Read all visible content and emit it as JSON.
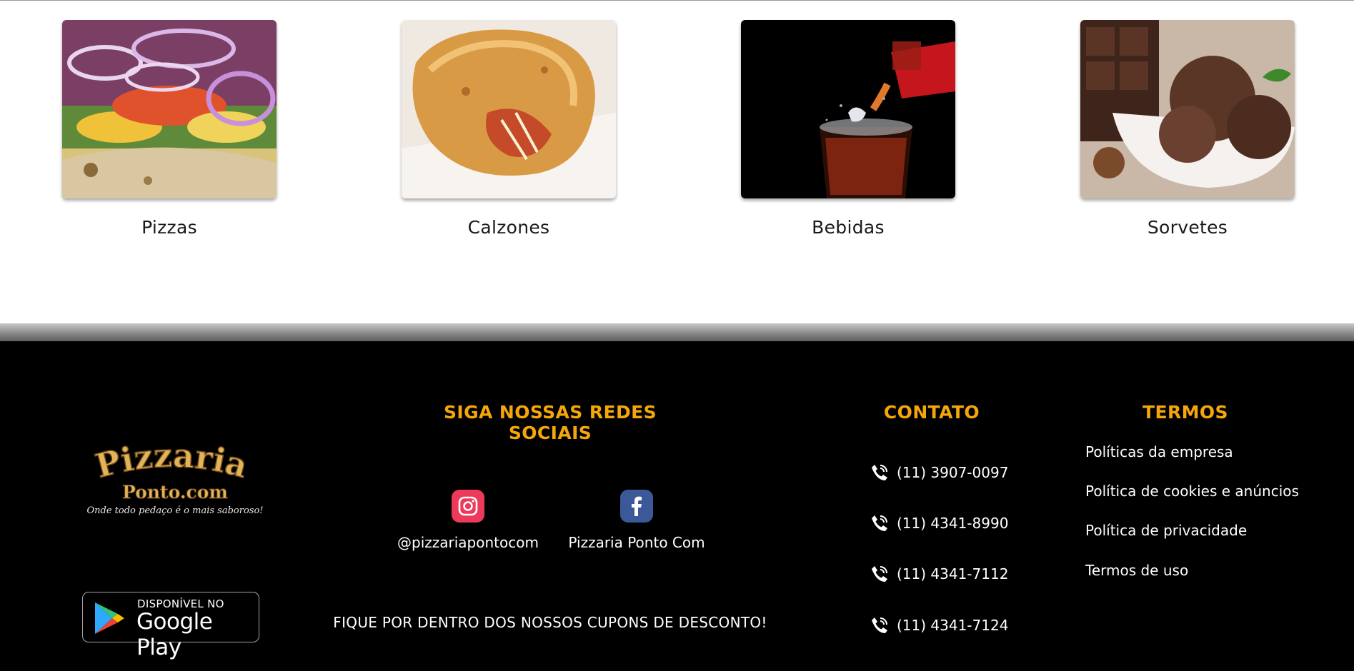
{
  "categories": [
    {
      "label": "Pizzas",
      "image": "pizza-photo"
    },
    {
      "label": "Calzones",
      "image": "calzone-photo"
    },
    {
      "label": "Bebidas",
      "image": "soda-photo"
    },
    {
      "label": "Sorvetes",
      "image": "ice-cream-photo"
    }
  ],
  "footer": {
    "logo": {
      "brand_line1": "Pizzaria",
      "brand_line2": "Ponto.com",
      "tagline": "Onde todo pedaço é o mais saboroso!"
    },
    "store_badge": {
      "small_text": "DISPONÍVEL NO",
      "big_text": "Google Play",
      "icon": "google-play-icon"
    },
    "social": {
      "heading": "SIGA NOSSAS REDES SOCIAIS",
      "accounts": [
        {
          "network": "instagram",
          "icon": "instagram-icon",
          "handle": "@pizzariapontocom"
        },
        {
          "network": "facebook",
          "icon": "facebook-icon",
          "handle": "Pizzaria Ponto Com"
        }
      ],
      "coupons_text": "FIQUE POR DENTRO DOS NOSSOS CUPONS DE DESCONTO!"
    },
    "contact": {
      "heading": "CONTATO",
      "phones": [
        "(11) 3907-0097",
        "(11) 4341-8990",
        "(11) 4341-7112",
        "(11) 4341-7124"
      ],
      "icon": "phone-icon"
    },
    "terms": {
      "heading": "TERMOS",
      "links": [
        "Políticas da empresa",
        "Política de cookies e anúncios",
        "Política de privacidade",
        "Termos de uso"
      ]
    }
  },
  "colors": {
    "accent": "#f5a60a",
    "footer_bg": "#000000",
    "instagram": "#ee3a5a",
    "facebook": "#3b5998"
  }
}
